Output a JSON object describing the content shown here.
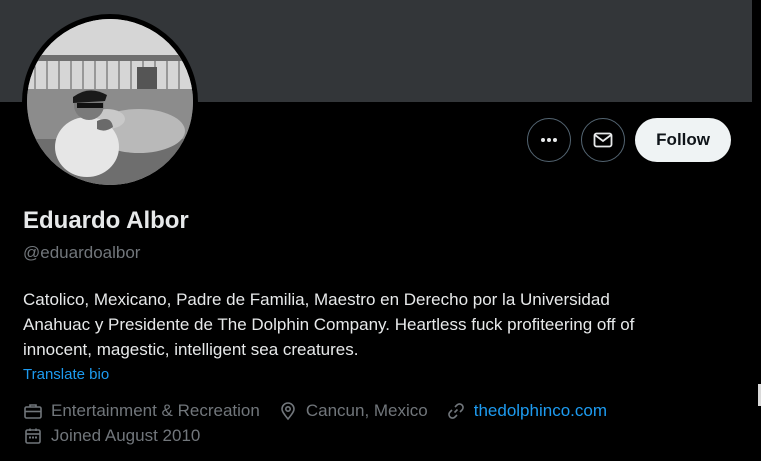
{
  "profile": {
    "name": "Eduardo Albor",
    "handle": "@eduardoalbor",
    "bio": "Catolico, Mexicano, Padre de Familia, Maestro en Derecho por la Universidad\nAnahuac y Presidente de The Dolphin Company.  Heartless fuck profiteering off of\ninnocent, magestic, intelligent sea creatures.",
    "translate_label": "Translate bio"
  },
  "actions": {
    "more_icon": "more-horizontal-icon",
    "message_icon": "envelope-icon",
    "follow_label": "Follow"
  },
  "meta": {
    "category": "Entertainment & Recreation",
    "location": "Cancun, Mexico",
    "website": "thedolphinco.com",
    "joined": "Joined August 2010"
  },
  "colors": {
    "background": "#000000",
    "banner": "#333639",
    "link": "#1d9bf0",
    "secondary_text": "#71767b",
    "follow_bg": "#eff3f4"
  }
}
